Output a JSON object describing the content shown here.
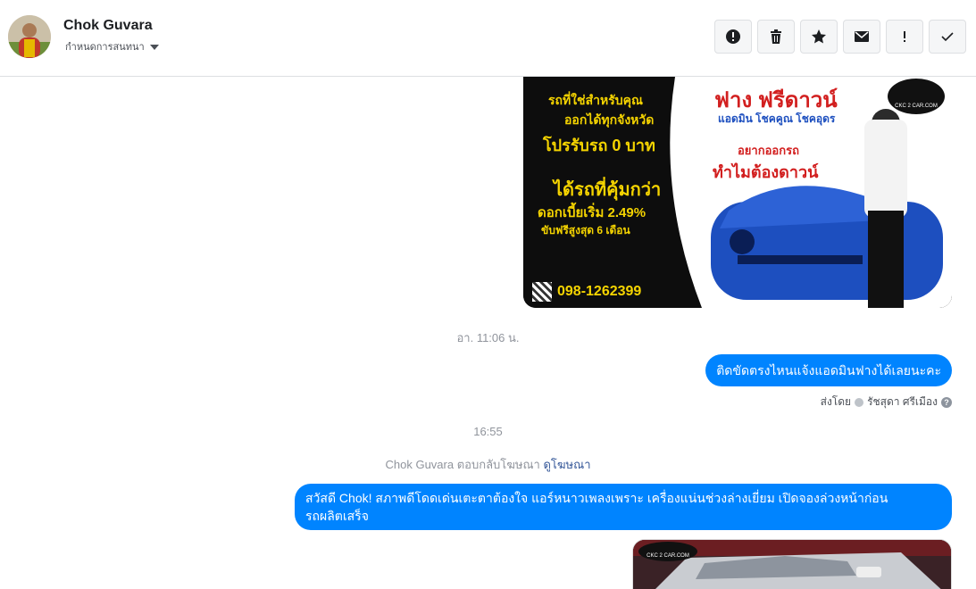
{
  "header": {
    "contact_name": "Chok Guvara",
    "subtitle": "กำหนดการสนทนา",
    "actions": [
      {
        "icon": "alert-circle-icon",
        "glyph": "!"
      },
      {
        "icon": "trash-icon"
      },
      {
        "icon": "star-icon"
      },
      {
        "icon": "mail-icon"
      },
      {
        "icon": "exclamation-icon",
        "glyph": "!"
      },
      {
        "icon": "check-icon"
      }
    ]
  },
  "ad_image_1": {
    "left_lines": [
      "รถที่ใช่สำหรับคุณ",
      "ออกได้ทุกจังหวัด",
      "โปรรับรถ 0 บาท",
      "ได้รถที่คุ้มกว่า",
      "ดอกเบี้ยเริ่ม 2.49%",
      "ขับฟรีสูงสุด 6 เดือน"
    ],
    "phone": "098-1262399",
    "headline": "ฟาง ฟรีดาวน์",
    "sub_headline": "แอดมิน โชคคูณ โชคอุดร",
    "tagline_1": "อยากออกรถ",
    "tagline_2": "ทำไมต้องดาวน์",
    "logo_text": "CKC 2 CAR.COM"
  },
  "messages": {
    "timestamp_1": "อา. 11:06 น.",
    "bubble_1": "ติดขัดตรงไหนแจ้งแอดมินฟางได้เลยนะคะ",
    "sent_by_label": "ส่งโดย",
    "sent_by_name": "รัชสุดา ศรีเมือง",
    "help_glyph": "?",
    "timestamp_2": "16:55",
    "reply_note": "Chok Guvara ตอบกลับโฆษณา",
    "reply_link": "ดูโฆษณา",
    "bubble_2_line1": "สวัสดี Chok! สภาพดีโดดเด่นเตะตาต้องใจ แอร์หนาวเพลงเพราะ เครื่องแน่นช่วงล่างเยี่ยม เปิดจองล่วงหน้าก่อน",
    "bubble_2_line2": "รถผลิตเสร็จ"
  },
  "ad_image_2": {
    "logo_text": "CKC 2 CAR.COM"
  },
  "colors": {
    "accent": "#0084ff",
    "ad_yellow": "#f5d400",
    "ad_red": "#d21f1f",
    "car_blue": "#1d4fbf"
  }
}
